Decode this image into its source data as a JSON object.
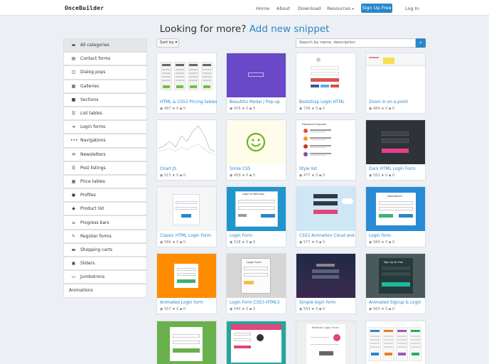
{
  "header": {
    "logo": "OnceBuilder",
    "nav": [
      "Home",
      "About",
      "Download",
      "Resources"
    ],
    "signup": "Sign Up Free",
    "login": "Log In"
  },
  "headline": {
    "prefix": "Looking for more?",
    "highlight": "Add new snippet"
  },
  "toolbar": {
    "sort_label": "Sort by",
    "search_placeholder": "Search by name, description"
  },
  "sidebar": {
    "items": [
      {
        "label": "All categories",
        "icon": "folder-icon"
      },
      {
        "label": "Contact forms",
        "icon": "card-icon"
      },
      {
        "label": "Dialog pops",
        "icon": "dialog-icon"
      },
      {
        "label": "Galleries",
        "icon": "image-icon"
      },
      {
        "label": "Sections",
        "icon": "square-icon"
      },
      {
        "label": "List tables",
        "icon": "list-icon"
      },
      {
        "label": "Login forms",
        "icon": "sign-in-icon"
      },
      {
        "label": "Navigations",
        "icon": "ellipsis-icon"
      },
      {
        "label": "Newsletters",
        "icon": "envelope-icon"
      },
      {
        "label": "Post listings",
        "icon": "list-icon"
      },
      {
        "label": "Price tables",
        "icon": "table-icon"
      },
      {
        "label": "Profiles",
        "icon": "user-icon"
      },
      {
        "label": "Product list",
        "icon": "tag-icon"
      },
      {
        "label": "Progress bars",
        "icon": "tasks-icon"
      },
      {
        "label": "Register forms",
        "icon": "edit-icon"
      },
      {
        "label": "Shopping carts",
        "icon": "cart-icon"
      },
      {
        "label": "Sliders",
        "icon": "sliders-icon"
      },
      {
        "label": "Jumbotrons",
        "icon": "jumbotron-icon"
      },
      {
        "label": "Animations",
        "icon": ""
      }
    ]
  },
  "cards": [
    {
      "title": "HTML & CSS3 Pricing tables",
      "stats": "487 ★ 0 ▪ 0",
      "thumb": "pricing"
    },
    {
      "title": "Beautiful Modal / Pop-up",
      "stats": "476 ★ 0 ▪ 0",
      "thumb": "purple"
    },
    {
      "title": "Bootstrap Login HTML",
      "stats": "736 ★ 0 ▪ 0",
      "thumb": "bootlogin"
    },
    {
      "title": "Zoom in on a point",
      "stats": "484 ★ 0 ▪ 0",
      "thumb": "zoom"
    },
    {
      "title": "Chart JS",
      "stats": "515 ★ 0 ▪ 0",
      "thumb": "chart"
    },
    {
      "title": "Smile CSS",
      "stats": "459 ★ 0 ▪ 0",
      "thumb": "smile"
    },
    {
      "title": "Style list",
      "stats": "477 ★ 0 ▪ 0",
      "thumb": "stylelist"
    },
    {
      "title": "Dark HTML Login Form",
      "stats": "552 ★ 0 ▪ 0",
      "thumb": "darklogin"
    },
    {
      "title": "Classic HTML Login Form",
      "stats": "566 ★ 0 ▪ 0",
      "thumb": "classic"
    },
    {
      "title": "Login Form",
      "stats": "528 ★ 0 ▪ 0",
      "thumb": "bluelogin"
    },
    {
      "title": "CSS3 Animation Cloud and",
      "stats": "577 ★ 0 ▪ 0",
      "thumb": "cloud"
    },
    {
      "title": "Login form",
      "stats": "584 ★ 0 ▪ 0",
      "thumb": "dashboard"
    },
    {
      "title": "Animated Login form",
      "stats": "557 ★ 0 ▪ 0",
      "thumb": "orange"
    },
    {
      "title": "Login Form CSS3 HTML5",
      "stats": "540 ★ 0 ▪ 0",
      "thumb": "graylogin"
    },
    {
      "title": "Simple login form",
      "stats": "543 ★ 0 ▪ 0",
      "thumb": "simple"
    },
    {
      "title": "Animated Signup & Login",
      "stats": "563 ★ 0 ▪ 0",
      "thumb": "signup"
    },
    {
      "title": "",
      "stats": "",
      "thumb": "green"
    },
    {
      "title": "",
      "stats": "",
      "thumb": "teal"
    },
    {
      "title": "",
      "stats": "",
      "thumb": "material"
    },
    {
      "title": "",
      "stats": "",
      "thumb": "pricing2"
    }
  ],
  "thumb_texts": {
    "login_title": "Login to Web App",
    "dashboard": "Dashboard",
    "login_form": "Login Form",
    "signup": "Sign Up for Free",
    "material": "Material Login Form",
    "followers": "Followed Channels"
  }
}
